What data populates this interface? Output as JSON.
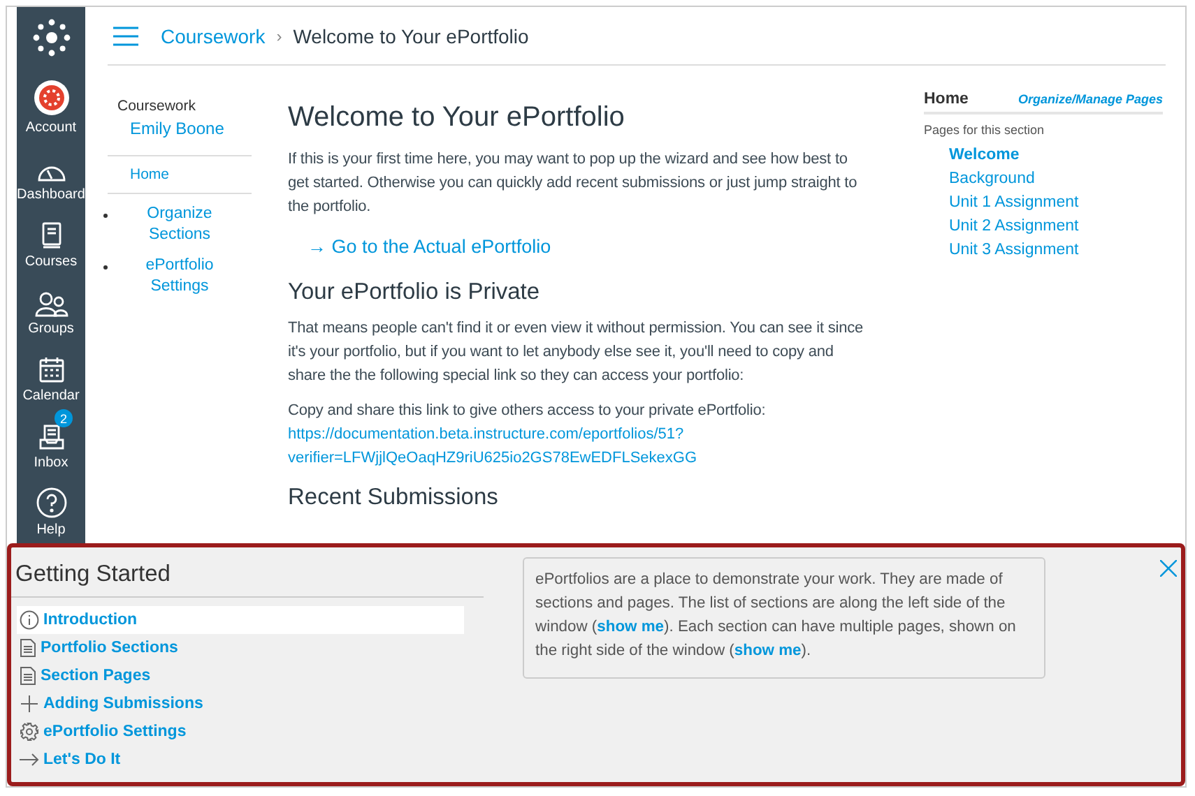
{
  "global_nav": [
    {
      "label": "Account",
      "selected": false
    },
    {
      "label": "Dashboard",
      "selected": false
    },
    {
      "label": "Courses",
      "selected": false
    },
    {
      "label": "Groups",
      "selected": false
    },
    {
      "label": "Calendar",
      "selected": false
    },
    {
      "label": "Inbox",
      "selected": false,
      "badge": "2"
    },
    {
      "label": "Help",
      "selected": false
    }
  ],
  "breadcrumb": {
    "parent": "Coursework",
    "separator": "›",
    "current": "Welcome to Your ePortfolio"
  },
  "portfolio": {
    "title": "Coursework",
    "owner": "Emily Boone"
  },
  "sections": [
    {
      "label": "Home",
      "selected": true
    },
    {
      "label": "Organize Sections",
      "selected": false
    },
    {
      "label": "ePortfolio Settings",
      "selected": false
    }
  ],
  "content": [
    {
      "kind": "h1",
      "text": "Welcome to Your ePortfolio"
    },
    {
      "kind": "p",
      "text": "If this is your first time here, you may want to pop up the wizard and see how best to get started. Otherwise you can quickly add recent submissions or just jump straight to the portfolio."
    },
    {
      "kind": "biglink",
      "text": "→ Go to the Actual ePortfolio"
    },
    {
      "kind": "h2",
      "text": "Your ePortfolio is Private"
    },
    {
      "kind": "p",
      "text": "That means people can't find it or even view it without permission. You can see it since it's your portfolio, but if you want to let anybody else see it, you'll need to copy and share the the following special link so they can access your portfolio:"
    },
    {
      "kind": "p",
      "text": "Copy and share this link to give others access to your private ePortfolio:"
    },
    {
      "kind": "url",
      "text": "https://documentation.beta.instructure.com/eportfolios/51?verifier=LFWjjlQeOaqHZ9riU625io2GS78EwEDFLSekexGG"
    },
    {
      "kind": "h2",
      "text": "Recent Submissions"
    }
  ],
  "pages_panel": {
    "section": "Home",
    "manage_link": "Organize/Manage Pages",
    "caption": "Pages for this section",
    "pages": [
      {
        "label": "Welcome",
        "selected": true
      },
      {
        "label": "Background",
        "selected": false
      },
      {
        "label": "Unit 1 Assignment",
        "selected": false
      },
      {
        "label": "Unit 2 Assignment",
        "selected": false
      },
      {
        "label": "Unit 3 Assignment",
        "selected": false
      }
    ]
  },
  "wizard": {
    "title": "Getting Started",
    "steps": [
      {
        "label": "Introduction",
        "selected": true
      },
      {
        "label": "Portfolio Sections",
        "selected": false
      },
      {
        "label": "Section Pages",
        "selected": false
      },
      {
        "label": "Adding Submissions",
        "selected": false
      },
      {
        "label": "ePortfolio Settings",
        "selected": false
      },
      {
        "label": "Let's Do It",
        "selected": false
      }
    ],
    "info": [
      {
        "kind": "text",
        "text": "ePortfolios are a place to demonstrate your work. They are made of sections and pages. The list of sections are along the left side of the window ("
      },
      {
        "kind": "link",
        "text": "show me"
      },
      {
        "kind": "text",
        "text": "). Each section can have multiple pages, shown on the right side of the window ("
      },
      {
        "kind": "link",
        "text": "show me"
      },
      {
        "kind": "text",
        "text": ")."
      }
    ]
  }
}
